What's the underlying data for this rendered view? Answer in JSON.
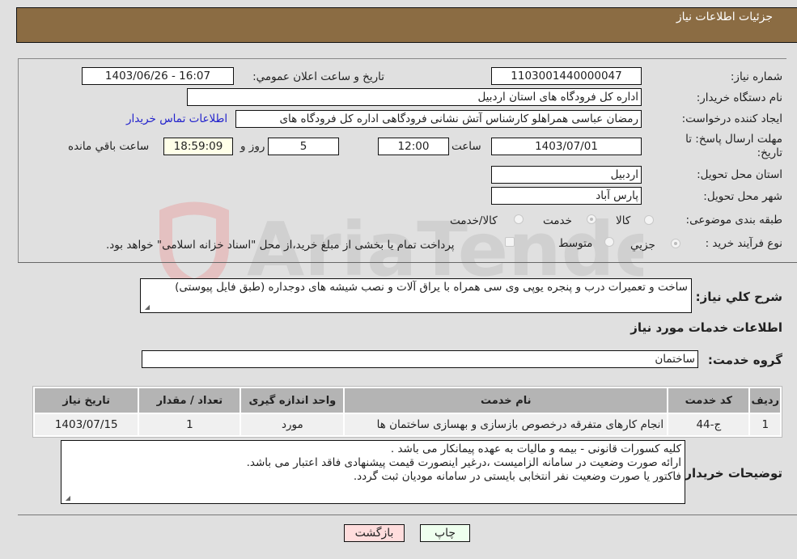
{
  "header": {
    "title": "جزئیات اطلاعات نیاز"
  },
  "form": {
    "need_number": {
      "label": "شماره نیاز:",
      "value": "1103001440000047"
    },
    "announce_datetime": {
      "label": "تاریخ و ساعت اعلان عمومي:",
      "value": "1403/06/26 - 16:07"
    },
    "buyer_org": {
      "label": "نام دستگاه خریدار:",
      "value": "اداره کل فرودگاه های استان اردبیل"
    },
    "requester": {
      "label": "ایجاد کننده درخواست:",
      "value": "رمضان عباسی همراهلو  کارشناس آتش نشانی فرودگاهی اداره کل فرودگاه های",
      "contact_link": "اطلاعات تماس خریدار"
    },
    "deadline": {
      "label": "مهلت ارسال پاسخ: تا تاریخ:",
      "date": "1403/07/01",
      "time_label": "ساعت",
      "time": "12:00",
      "days": "5",
      "days_label": "روز و",
      "remaining": "18:59:09",
      "remaining_label": "ساعت باقي مانده"
    },
    "delivery_province": {
      "label": "استان محل تحویل:",
      "value": "اردبیل"
    },
    "delivery_city": {
      "label": "شهر محل تحویل:",
      "value": "پارس آباد"
    },
    "category": {
      "label": "طبقه بندی موضوعی:",
      "options": [
        "کالا",
        "خدمت",
        "کالا/خدمت"
      ],
      "selected": "خدمت"
    },
    "process_type": {
      "label": "نوع فرآیند خرید :",
      "options": [
        "جزیي",
        "متوسط"
      ],
      "selected": "جزیي",
      "treasury_note": "پرداخت تمام یا بخشی از مبلغ خرید،از محل \"اسناد خزانه اسلامی\" خواهد بود."
    }
  },
  "description": {
    "label": "شرح كلي نياز:",
    "value": "ساخت و تعمیرات درب و پنجره  یوپی وی سی همراه با یراق آلات و نصب شیشه های دوجداره (طبق فایل پیوستی)"
  },
  "services_section": {
    "title": "اطلاعات خدمات مورد نیاز"
  },
  "service_group": {
    "label": "گروه خدمت:",
    "value": "ساختمان"
  },
  "services_table": {
    "headers": [
      "ردیف",
      "کد خدمت",
      "نام خدمت",
      "واحد اندازه گیری",
      "تعداد / مقدار",
      "تاریخ نیاز"
    ],
    "rows": [
      [
        "1",
        "ج-44",
        "انجام کارهای متفرقه درخصوص بازسازی و بهسازی ساختمان ها",
        "مورد",
        "1",
        "1403/07/15"
      ]
    ]
  },
  "buyer_notes": {
    "label": "توضیحات خریدار:",
    "lines": [
      "کلیه کسورات قانونی - بیمه و مالیات به عهده پیمانکار می باشد .",
      "ارائه صورت وضعیت در سامانه الزامیست ،درغیر اینصورت قیمت پیشنهادی فاقد اعتبار می باشد.",
      "فاکتور یا صورت وضعیت نفر انتخابی بایستی در سامانه مودیان ثبت گردد."
    ]
  },
  "buttons": {
    "print": "چاپ",
    "back": "بازگشت"
  },
  "colors": {
    "header_bg": "#8b6c43",
    "print_bg": "#eeffee",
    "back_bg": "#ffdddd",
    "link": "#2222cc"
  }
}
